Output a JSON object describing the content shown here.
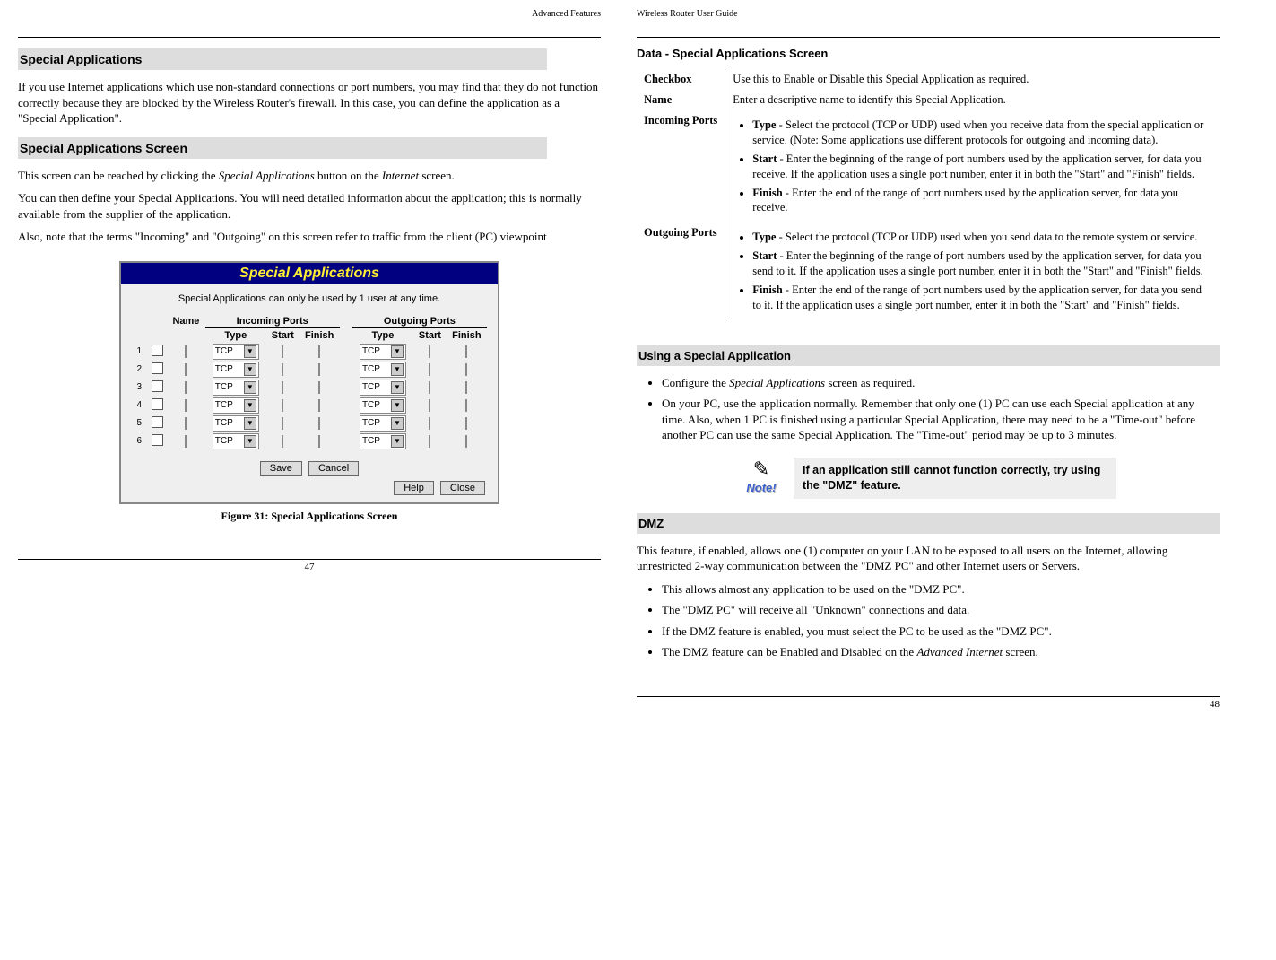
{
  "left": {
    "header": "Advanced Features",
    "h_special_apps": "Special Applications",
    "p_intro": "If you use Internet applications which use non-standard connections or port numbers, you may find that they do not function correctly because they are blocked by the Wireless Router's firewall. In this case, you can define the application as a \"Special Application\".",
    "h_screen": "Special Applications Screen",
    "p_reach_1": "This screen can be reached by clicking the ",
    "p_reach_em": "Special Applications",
    "p_reach_2": " button on the ",
    "p_reach_em2": "Internet",
    "p_reach_3": " screen.",
    "p_define": "You can then define your Special Applications. You will need detailed information about the application; this is normally available from the supplier of the application.",
    "p_terms": "Also, note that the terms \"Incoming\" and \"Outgoing\" on this screen refer to traffic from the client (PC) viewpoint",
    "fig": {
      "title": "Special Applications",
      "subtitle": "Special Applications can only be used by 1 user at any time.",
      "col_name": "Name",
      "col_incoming": "Incoming Ports",
      "col_outgoing": "Outgoing Ports",
      "col_type": "Type",
      "col_start": "Start",
      "col_finish": "Finish",
      "sel_val": "TCP",
      "rows": [
        "1.",
        "2.",
        "3.",
        "4.",
        "5.",
        "6."
      ],
      "btn_save": "Save",
      "btn_cancel": "Cancel",
      "btn_help": "Help",
      "btn_close": "Close"
    },
    "caption": "Figure 31: Special Applications Screen",
    "page": "47"
  },
  "right": {
    "header": "Wireless Router User Guide",
    "h_data": "Data - Special Applications Screen",
    "table": {
      "checkbox_l": "Checkbox",
      "checkbox_d": "Use this to Enable or Disable this Special Application as required.",
      "name_l": "Name",
      "name_d": "Enter a descriptive name to identify this Special Application.",
      "inc_l": "Incoming Ports",
      "inc_type_b": "Type",
      "inc_type": " - Select the protocol (TCP or UDP) used when you receive data from the special application or service. (Note: Some applications use different protocols for outgoing and incoming data).",
      "inc_start_b": "Start",
      "inc_start": " - Enter the beginning of the range of port numbers used by the application server, for data you receive. If the application uses a single port number, enter it in both the \"Start\" and \"Finish\" fields.",
      "inc_finish_b": "Finish",
      "inc_finish": " - Enter the end of the range of port numbers used by the application server, for data you receive.",
      "out_l": "Outgoing Ports",
      "out_type_b": "Type",
      "out_type": " - Select the protocol (TCP or UDP) used when you send data to the remote system or service.",
      "out_start_b": "Start",
      "out_start": " - Enter the beginning of the range of port numbers used by the application server, for data you send to it. If the application uses a single port number, enter it in both the \"Start\" and \"Finish\" fields.",
      "out_finish_b": "Finish",
      "out_finish": " - Enter the end of the range of port numbers used by the application server, for data you send to it. If the application uses a single port number, enter it in both the \"Start\" and \"Finish\" fields."
    },
    "h_using": "Using a Special Application",
    "using1_a": "Configure the ",
    "using1_em": "Special Applications",
    "using1_b": " screen as required.",
    "using2": "On your PC, use the application normally. Remember that only one (1) PC can use each Special application at any time. Also, when 1 PC is finished using a particular Special Application, there may need to be a \"Time-out\" before another PC can use the same Special Application. The \"Time-out\" period may be up to 3 minutes.",
    "note_label": "Note!",
    "note_text": "If an application still cannot function correctly, try using the \"DMZ\" feature.",
    "h_dmz": "DMZ",
    "dmz_p": "This feature, if enabled, allows one (1) computer on your LAN to be exposed to all users on the Internet, allowing unrestricted 2-way communication between the \"DMZ PC\" and other Internet users or Servers.",
    "dmz1": "This allows almost any application to be used on the \"DMZ PC\".",
    "dmz2": "The \"DMZ PC\" will receive all \"Unknown\" connections and data.",
    "dmz3": "If the DMZ feature is enabled, you must select the PC to be used as the \"DMZ PC\".",
    "dmz4_a": "The DMZ feature can be Enabled and Disabled on the ",
    "dmz4_em": "Advanced Internet",
    "dmz4_b": " screen.",
    "page": "48"
  }
}
